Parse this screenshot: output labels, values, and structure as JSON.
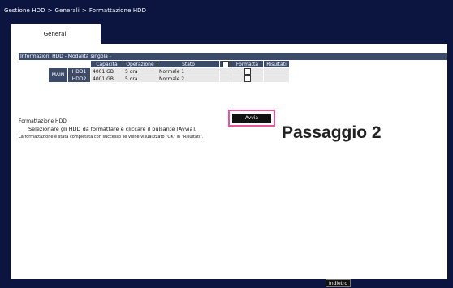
{
  "breadcrumb": {
    "items": [
      "Gestione HDD",
      "Generali",
      "Formattazione HDD"
    ],
    "separator": ">"
  },
  "tabs": [
    {
      "label": "Generali",
      "active": true
    }
  ],
  "hdd_info": {
    "section_title": "Informazioni HDD - Modalità singola -",
    "columns": {
      "capacity": "Capacità",
      "operation": "Operazione",
      "status": "Stato",
      "format": "Formatta",
      "results": "Risultati"
    },
    "group_label": "MAIN",
    "rows": [
      {
        "name": "HDD1",
        "capacity": "4001 GB",
        "operation": "5 ora",
        "status": "Normale 1",
        "format_checked": false,
        "result": ""
      },
      {
        "name": "HDD2",
        "capacity": "4001 GB",
        "operation": "5 ora",
        "status": "Normale 2",
        "format_checked": false,
        "result": ""
      }
    ]
  },
  "format_section": {
    "title": "Formattazione HDD",
    "instruction": "Selezionare gli HDD da formattare e cliccare il pulsante [Avvia].",
    "note": "La formattazione è stata completata con successo se viene visualizzato \"OK\" in \"Risultati\".",
    "start_button": "Avvia"
  },
  "annotation": {
    "label": "Passaggio 2",
    "highlight_color": "#e8559a"
  },
  "footer": {
    "back_button": "Indietro"
  },
  "colors": {
    "background": "#0b1540",
    "header_cell": "#3d4b6b",
    "data_cell": "#e8e8e8"
  }
}
